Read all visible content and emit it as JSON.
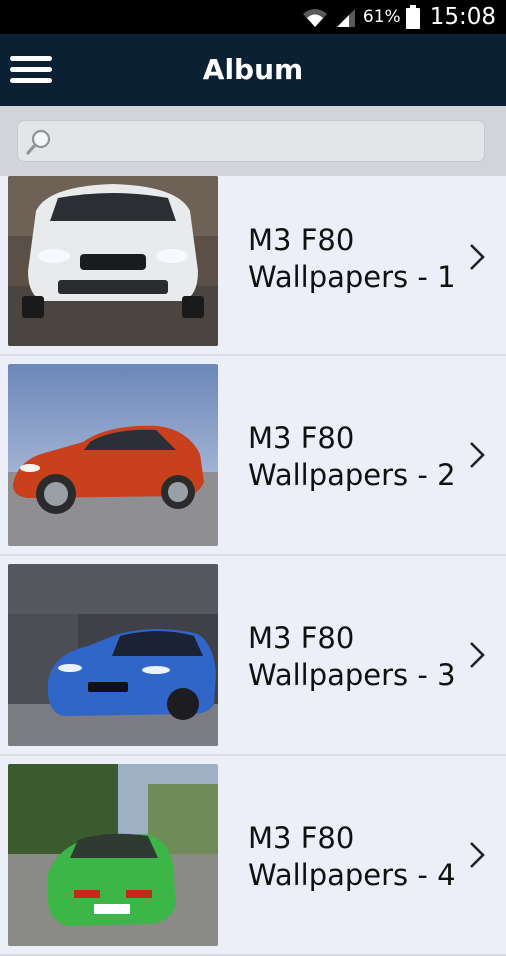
{
  "status_bar": {
    "battery_percent": "61%",
    "time": "15:08"
  },
  "app_bar": {
    "title": "Album",
    "menu_icon": "hamburger-menu-icon"
  },
  "search": {
    "placeholder": "",
    "value": "",
    "icon": "search-icon"
  },
  "album": {
    "items": [
      {
        "line1": "M3 F80",
        "line2": "Wallpapers - 1",
        "car_color": "#E8EAEC"
      },
      {
        "line1": "M3 F80",
        "line2": "Wallpapers - 2",
        "car_color": "#C8401C"
      },
      {
        "line1": "M3 F80",
        "line2": "Wallpapers - 3",
        "car_color": "#2F66C8"
      },
      {
        "line1": "M3 F80",
        "line2": "Wallpapers - 4",
        "car_color": "#3DB648"
      }
    ]
  },
  "colors": {
    "app_bar": "#0C2033",
    "list_background": "#ECEEF8",
    "search_area": "#D2D4D9"
  }
}
